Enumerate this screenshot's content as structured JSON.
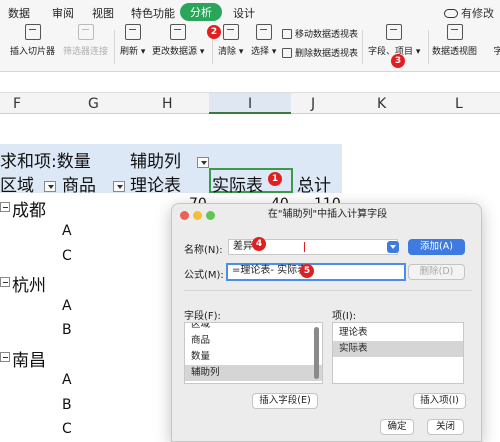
{
  "menu": {
    "items": [
      "数据",
      "审阅",
      "视图",
      "特色功能",
      "分析",
      "设计"
    ],
    "active": "分析",
    "brand": "有修改"
  },
  "ribbon": {
    "insert_slicer": "插入切片器",
    "filter_connection": "筛选器连接",
    "refresh": "刷新",
    "change_source": "更改数据源",
    "clear": "清除",
    "select": "选择",
    "move_pivot": "移动数据透视表",
    "delete_pivot": "删除数据透视表",
    "fields_items": "字段、项目",
    "pivot_chart": "数据透视图",
    "more": "字"
  },
  "badges": {
    "b1": "1",
    "b2": "2",
    "b3": "3",
    "b4": "4",
    "b5": "5"
  },
  "columns": [
    "F",
    "G",
    "H",
    "I",
    "J",
    "K",
    "L"
  ],
  "pivot": {
    "sum_label": "求和项:数量",
    "aux_col": "辅助列",
    "region": "区域",
    "product": "商品",
    "theory": "理论表",
    "actual": "实际表",
    "total": "总计",
    "values_row": [
      "70",
      "40",
      "110"
    ],
    "groups": [
      {
        "name": "成都",
        "items": [
          "A",
          "C"
        ]
      },
      {
        "name": "杭州",
        "items": [
          "A",
          "B"
        ]
      },
      {
        "name": "南昌",
        "items": [
          "A",
          "B",
          "C"
        ]
      }
    ]
  },
  "dialog": {
    "title": "在\"辅助列\"中插入计算字段",
    "name_label": "名称(N):",
    "name_value": "差异",
    "formula_label": "公式(M):",
    "formula_value": "=理论表- 实际表",
    "add_button": "添加(A)",
    "delete_button": "删除(D)",
    "fields_label": "字段(F):",
    "fields": [
      "区域",
      "商品",
      "数量",
      "辅助列"
    ],
    "selected_field": "辅助列",
    "items_label": "项(I):",
    "items": [
      "理论表",
      "实际表"
    ],
    "selected_item": "实际表",
    "insert_field_button": "插入字段(E)",
    "insert_item_button": "插入项(I)",
    "ok_button": "确定",
    "close_button": "关闭"
  },
  "colors": {
    "accent_green": "#2aa55a",
    "pivot_header_blue": "#dde8f6",
    "badge_red": "#e02020",
    "dialog_blue": "#3d7be0"
  }
}
